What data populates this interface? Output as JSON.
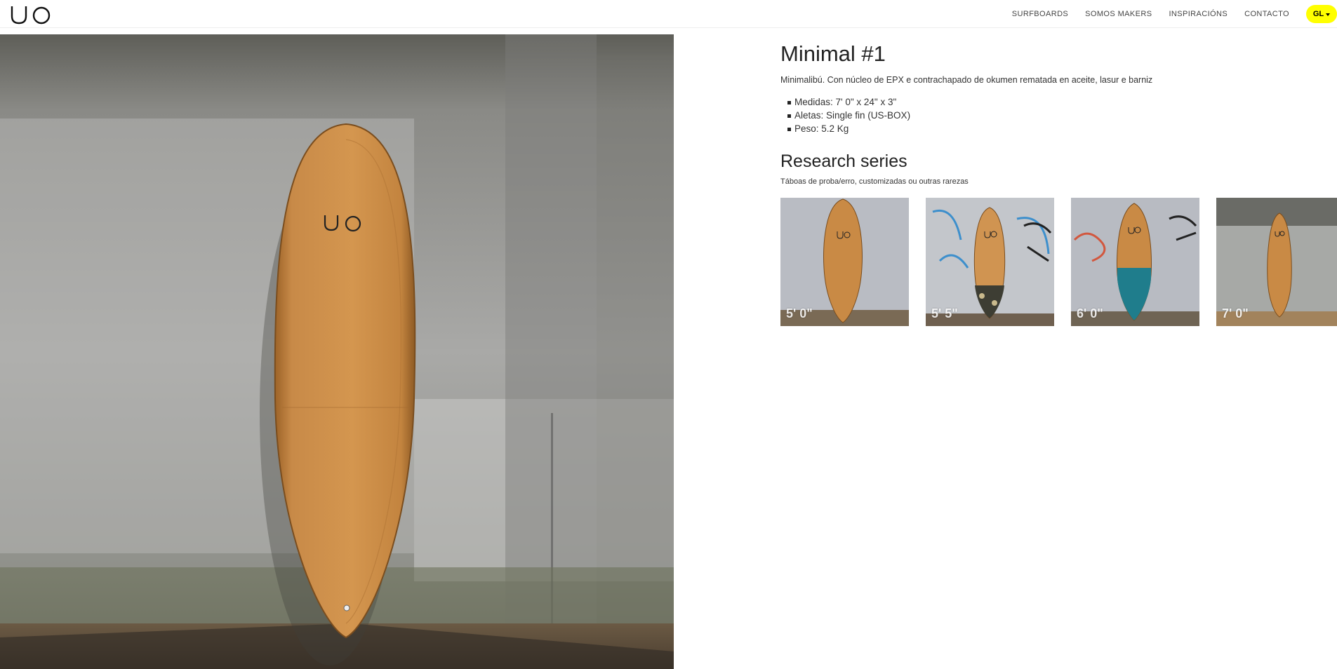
{
  "header": {
    "logo": "UO",
    "nav": [
      {
        "label": "SURFBOARDS"
      },
      {
        "label": "SOMOS MAKERS"
      },
      {
        "label": "INSPIRACIÓNS"
      },
      {
        "label": "CONTACTO"
      }
    ],
    "language": "GL"
  },
  "product": {
    "title": "Minimal #1",
    "description": "Minimalibú. Con núcleo de EPX e contrachapado de okumen rematada en aceite, lasur e barniz",
    "specs": [
      "Medidas: 7' 0\" x 24\" x 3\"",
      "Aletas: Single fin (US-BOX)",
      "Peso: 5.2 Kg"
    ]
  },
  "series": {
    "title": "Research series",
    "subtitle": "Táboas de proba/erro, customizadas ou outras rarezas",
    "items": [
      {
        "size": "5' 0\""
      },
      {
        "size": "5' 5\""
      },
      {
        "size": "6' 0\""
      },
      {
        "size": "7' 0\""
      }
    ]
  },
  "colors": {
    "accent": "#ffff00",
    "board_wood": "#c98a45",
    "wall": "#9a9a98"
  }
}
